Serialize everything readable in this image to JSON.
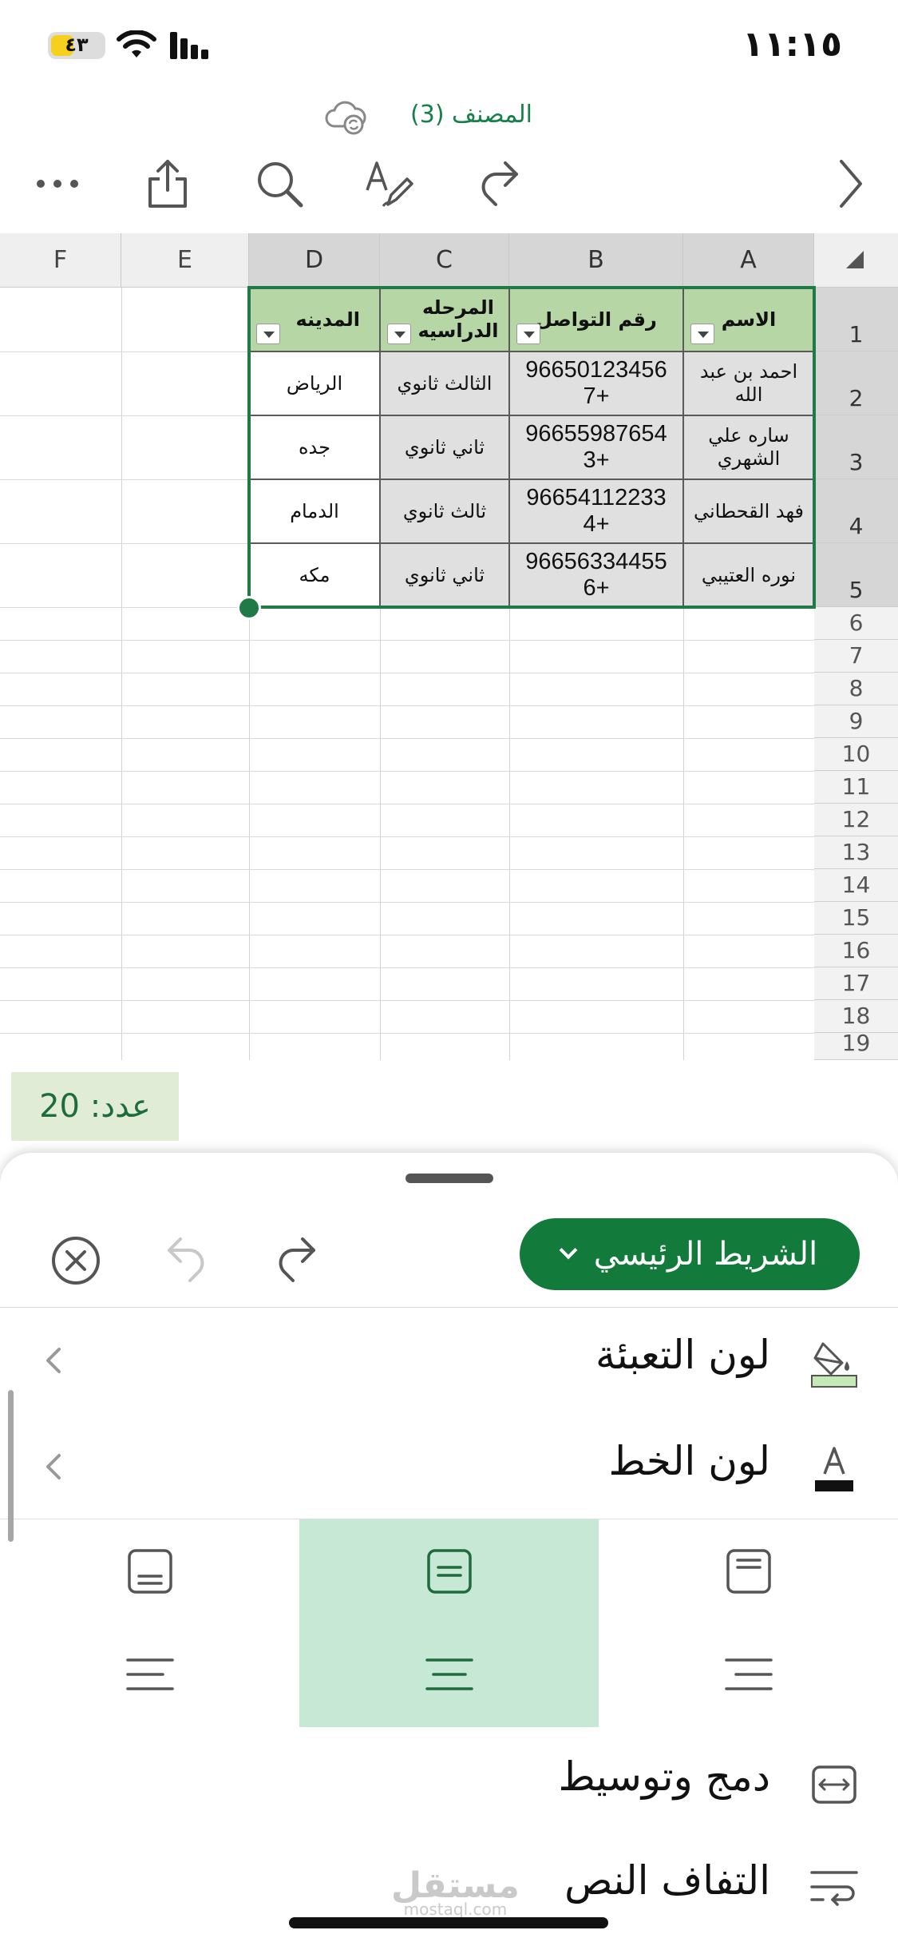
{
  "status_bar": {
    "time": "١١:١٥",
    "battery": "٤٣",
    "battery_level": 0.43
  },
  "document": {
    "title": "المصنف (3)"
  },
  "toolbar": {
    "icons": [
      "more-icon",
      "share-icon",
      "search-icon",
      "draw-icon",
      "redo-icon",
      "forward-chevron-icon"
    ]
  },
  "columns": [
    "F",
    "E",
    "D",
    "C",
    "B",
    "A"
  ],
  "rows": [
    "1",
    "2",
    "3",
    "4",
    "5",
    "6",
    "7",
    "8",
    "9",
    "10",
    "11",
    "12",
    "13",
    "14",
    "15",
    "16",
    "17",
    "18",
    "19"
  ],
  "table": {
    "headers": [
      "الاسم",
      "رقم التواصل",
      "المرحله الدراسيه",
      "المدينه"
    ],
    "rows": [
      [
        "احمد بن عبد الله",
        "96650123456 7+",
        "الثالث ثانوي",
        "الرياض"
      ],
      [
        "ساره علي الشهري",
        "96655987654 3+",
        "ثاني ثانوي",
        "جده"
      ],
      [
        "فهد القحطاني",
        "96654112233 4+",
        "ثالث ثانوي",
        "الدمام"
      ],
      [
        "نوره العتيبي",
        "96656334455 6+",
        "ثاني ثانوي",
        "مكه"
      ]
    ],
    "header_fill": "#b7d6a6",
    "cell_fill": "#e0e0e0"
  },
  "status": {
    "count": "عدد: 20"
  },
  "sheet": {
    "ribbon_label": "الشريط الرئيسي",
    "menu": {
      "fill_color": "لون التعبئة",
      "font_color": "لون الخط",
      "merge_center": "دمج وتوسيط",
      "wrap_text": "التفاف النص"
    }
  },
  "watermark": {
    "brand": "مستقل",
    "site": "mostaql.com"
  },
  "colors": {
    "accent": "#127a3b",
    "selection": "#1f7a46",
    "active_align": "#c6e8d4"
  }
}
